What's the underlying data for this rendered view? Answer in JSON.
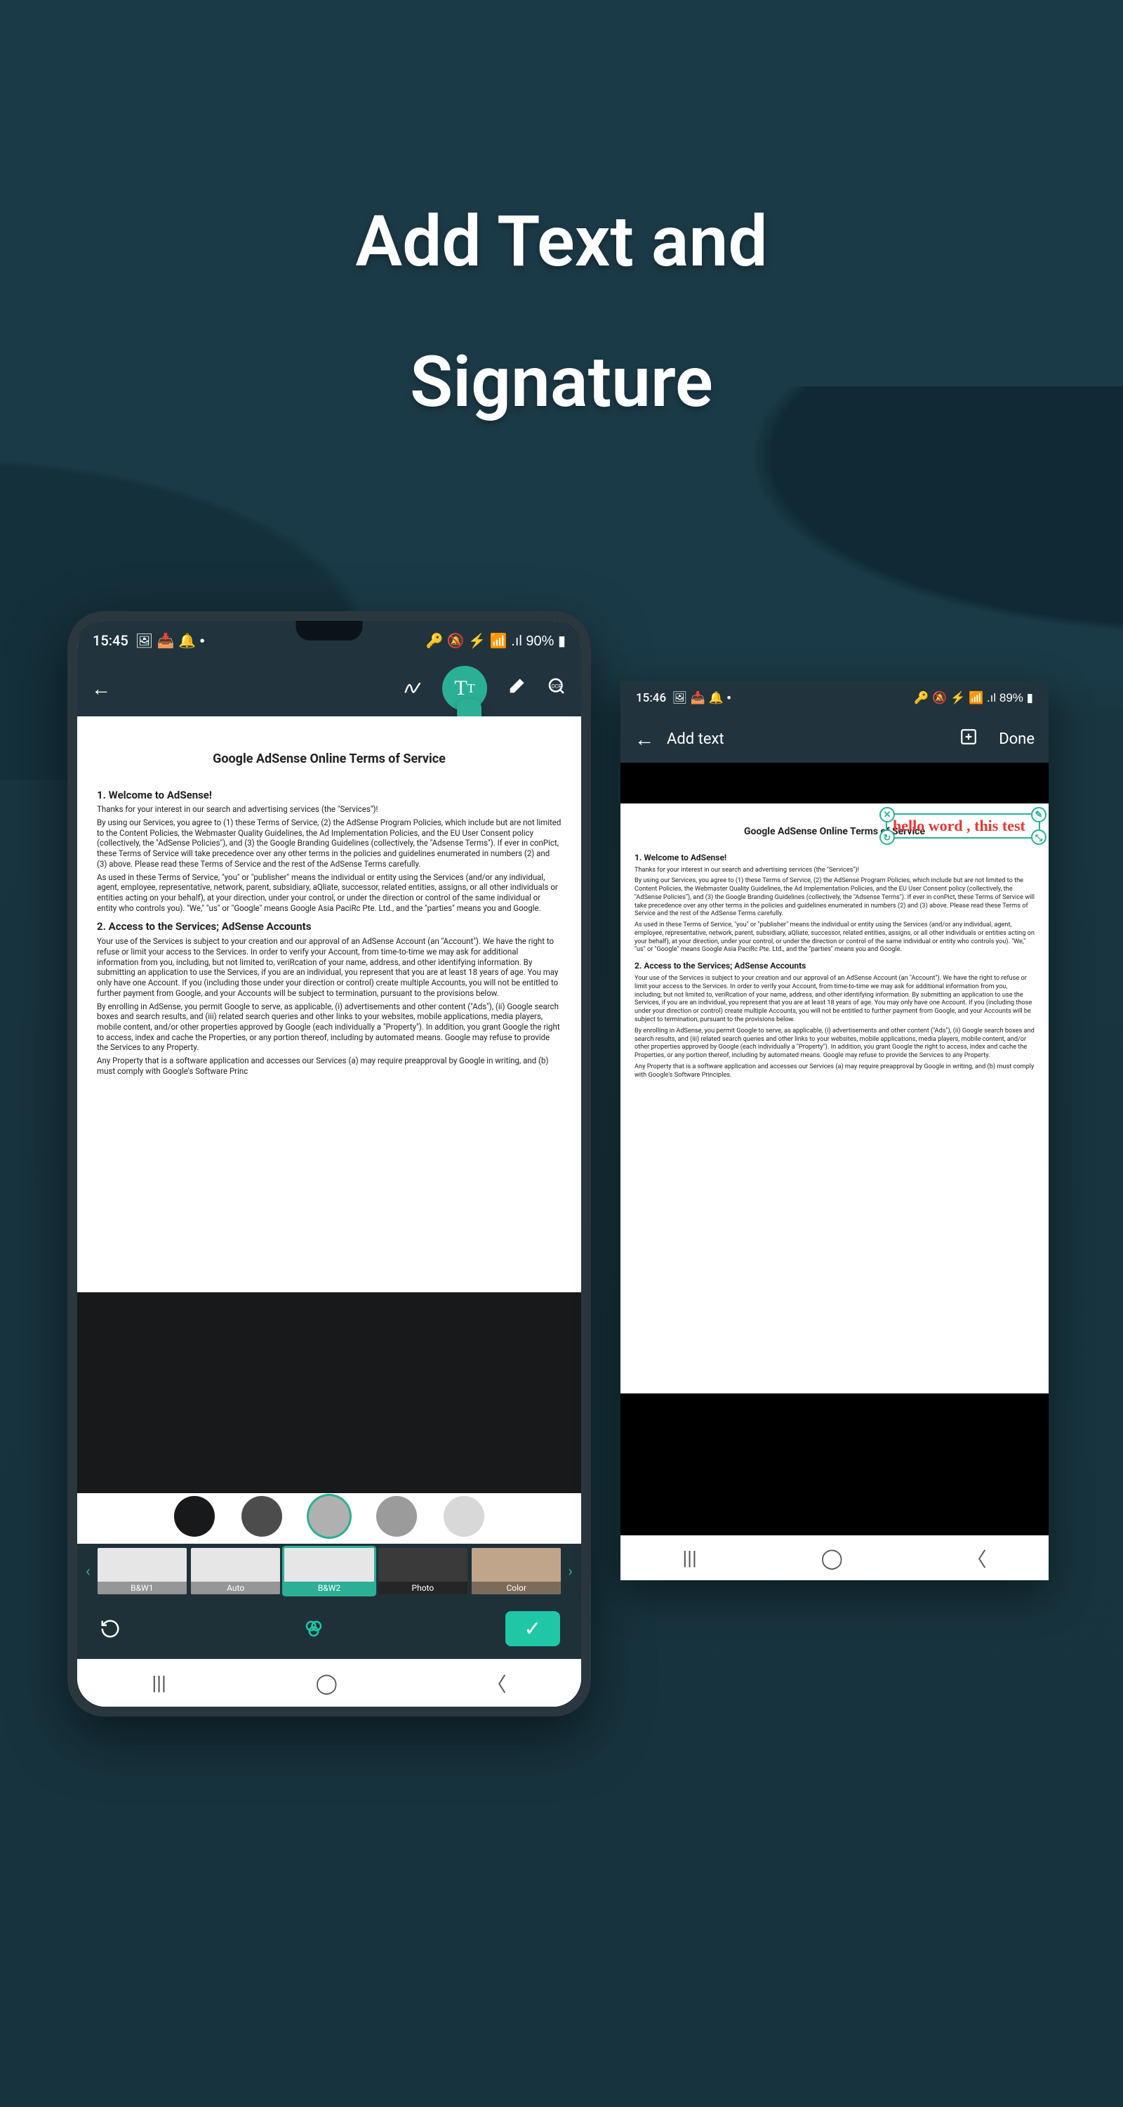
{
  "hero": {
    "line1": "Add Text and",
    "line2": "Signature"
  },
  "phone1": {
    "status": {
      "time": "15:45",
      "indicators": "🖼 📥 🔔 •",
      "right": "🔑 🔕 ⚡ 📶 .ıl 90% ▮"
    },
    "doc": {
      "title": "Google AdSense Online Terms of Service",
      "h1": "1.  Welcome to AdSense!",
      "p1": "Thanks for your interest in our search and advertising services (the \"Services\")!",
      "p2": "By using our Services, you agree to (1) these Terms of Service, (2) the AdSense Program Policies, which include but are not limited to the Content Policies, the Webmaster Quality Guidelines, the Ad Implementation Policies, and the EU User Consent policy (collectively, the \"AdSense Policies\"), and (3) the Google Branding Guidelines (collectively, the \"Adsense Terms\"). If ever in conPict, these Terms of Service will take precedence over any other terms in the policies and guidelines enumerated in numbers (2) and (3) above. Please read these Terms of Service and the rest of the AdSense Terms carefully.",
      "p3": "As used in these Terms of Service, \"you\" or \"publisher\" means the individual or entity using the Services (and/or any individual, agent, employee, representative, network, parent, subsidiary, aQliate, successor, related entities, assigns, or all other individuals or entities acting on your behalf), at your direction, under your control, or under the direction or control of the same individual or entity who controls you). \"We,\" \"us\" or \"Google\" means Google Asia PaciRc Pte. Ltd., and the \"parties\" means you and Google.",
      "h2": "2. Access to the Services; AdSense Accounts",
      "p4": "Your use of the Services is subject to your creation and our approval of an AdSense Account (an \"Account\"). We have the right to refuse or limit your access to the Services. In order to verify your Account, from time-to-time we may ask for additional information from you, including, but not limited to, veriRcation of your name, address, and other identifying information. By submitting an application to use the Services, if you are an individual, you represent that you are at least 18 years of age. You may only have one Account. If you (including those under your direction or control) create multiple Accounts, you will not be entitled to further payment from Google, and your Accounts will be subject to termination, pursuant to the provisions below.",
      "p5": "By enrolling in AdSense, you permit Google to serve, as applicable, (i) advertisements and other content (\"Ads\"), (ii) Google search boxes and search results, and (iii) related search queries and other links to your websites, mobile applications, media players, mobile content, and/or other properties approved by Google (each individually a \"Property\"). In addition, you grant Google the right to access, index and cache the Properties, or any portion thereof, including by automated means. Google may refuse to provide the Services to any Property.",
      "p6": "Any Property that is a software application and accesses our Services (a) may require preapproval by Google in writing, and (b) must comply with Google's Software Princ"
    },
    "swatches": [
      "#17191b",
      "#4c4c4c",
      "#b0b0b0",
      "#9b9b9b",
      "#d8d8d8"
    ],
    "swatch_selected": 2,
    "filters": [
      "B&W1",
      "Auto",
      "B&W2",
      "Photo",
      "Color"
    ],
    "filter_selected": 2
  },
  "phone2": {
    "status": {
      "time": "15:46",
      "indicators": "🖼 📥 🔔 •",
      "right": "🔑 🔕 ⚡ 📶 .ıl 89% ▮"
    },
    "toolbar": {
      "title": "Add text",
      "done": "Done"
    },
    "textbox": "hello word , this test",
    "doc": {
      "title": "Google AdSense Online Terms of Service",
      "h1": "1.  Welcome to AdSense!",
      "p1": "Thanks for your interest in our search and advertising services (the \"Services\")!",
      "p2": "By using our Services, you agree to (1) these Terms of Service, (2) the AdSense Program Policies, which include but are not limited to the Content Policies, the Webmaster Quality Guidelines, the Ad Implementation Policies, and the EU User Consent policy (collectively, the \"AdSense Policies\"), and (3) the Google Branding Guidelines (collectively, the \"Adsense Terms\"). If ever in conPict, these Terms of Service will take precedence over any other terms in the policies and guidelines enumerated in numbers (2) and (3) above. Please read these Terms of Service and the rest of the AdSense Terms carefully.",
      "p3": "As used in these Terms of Service, \"you\" or \"publisher\" means the individual or entity using the Services (and/or any individual, agent, employee, representative, network, parent, subsidiary, aQliate, successor, related entities, assigns, or all other individuals or entities acting on your behalf), at your direction, under your control, or under the direction or control of the same individual or entity who controls you). \"We,\" \"us\" or \"Google\" means Google Asia PaciRc Pte. Ltd., and the \"parties\" means you and Google.",
      "h2": "2. Access to the Services; AdSense Accounts",
      "p4": "Your use of the Services is subject to your creation and our approval of an AdSense Account (an \"Account\"). We have the right to refuse or limit your access to the Services. In order to verify your Account, from time-to-time we may ask for additional information from you, including, but not limited to, veriRcation of your name, address, and other identifying information. By submitting an application to use the Services, if you are an individual, you represent that you are at least 18 years of age. You may only have one Account. If you (including those under your direction or control) create multiple Accounts, you will not be entitled to further payment from Google, and your Accounts will be subject to termination, pursuant to the provisions below.",
      "p5": "By enrolling in AdSense, you permit Google to serve, as applicable, (i) advertisements and other content (\"Ads\"), (ii) Google search boxes and search results, and (iii) related search queries and other links to your websites, mobile applications, media players, mobile content, and/or other properties approved by Google (each individually a \"Property\"). In addition, you grant Google the right to access, index and cache the Properties, or any portion thereof, including by automated means. Google may refuse to provide the Services to any Property.",
      "p6": "Any Property that is a software application and accesses our Services (a) may require preapproval by Google in writing, and (b) must comply with Google's Software Principles."
    }
  }
}
